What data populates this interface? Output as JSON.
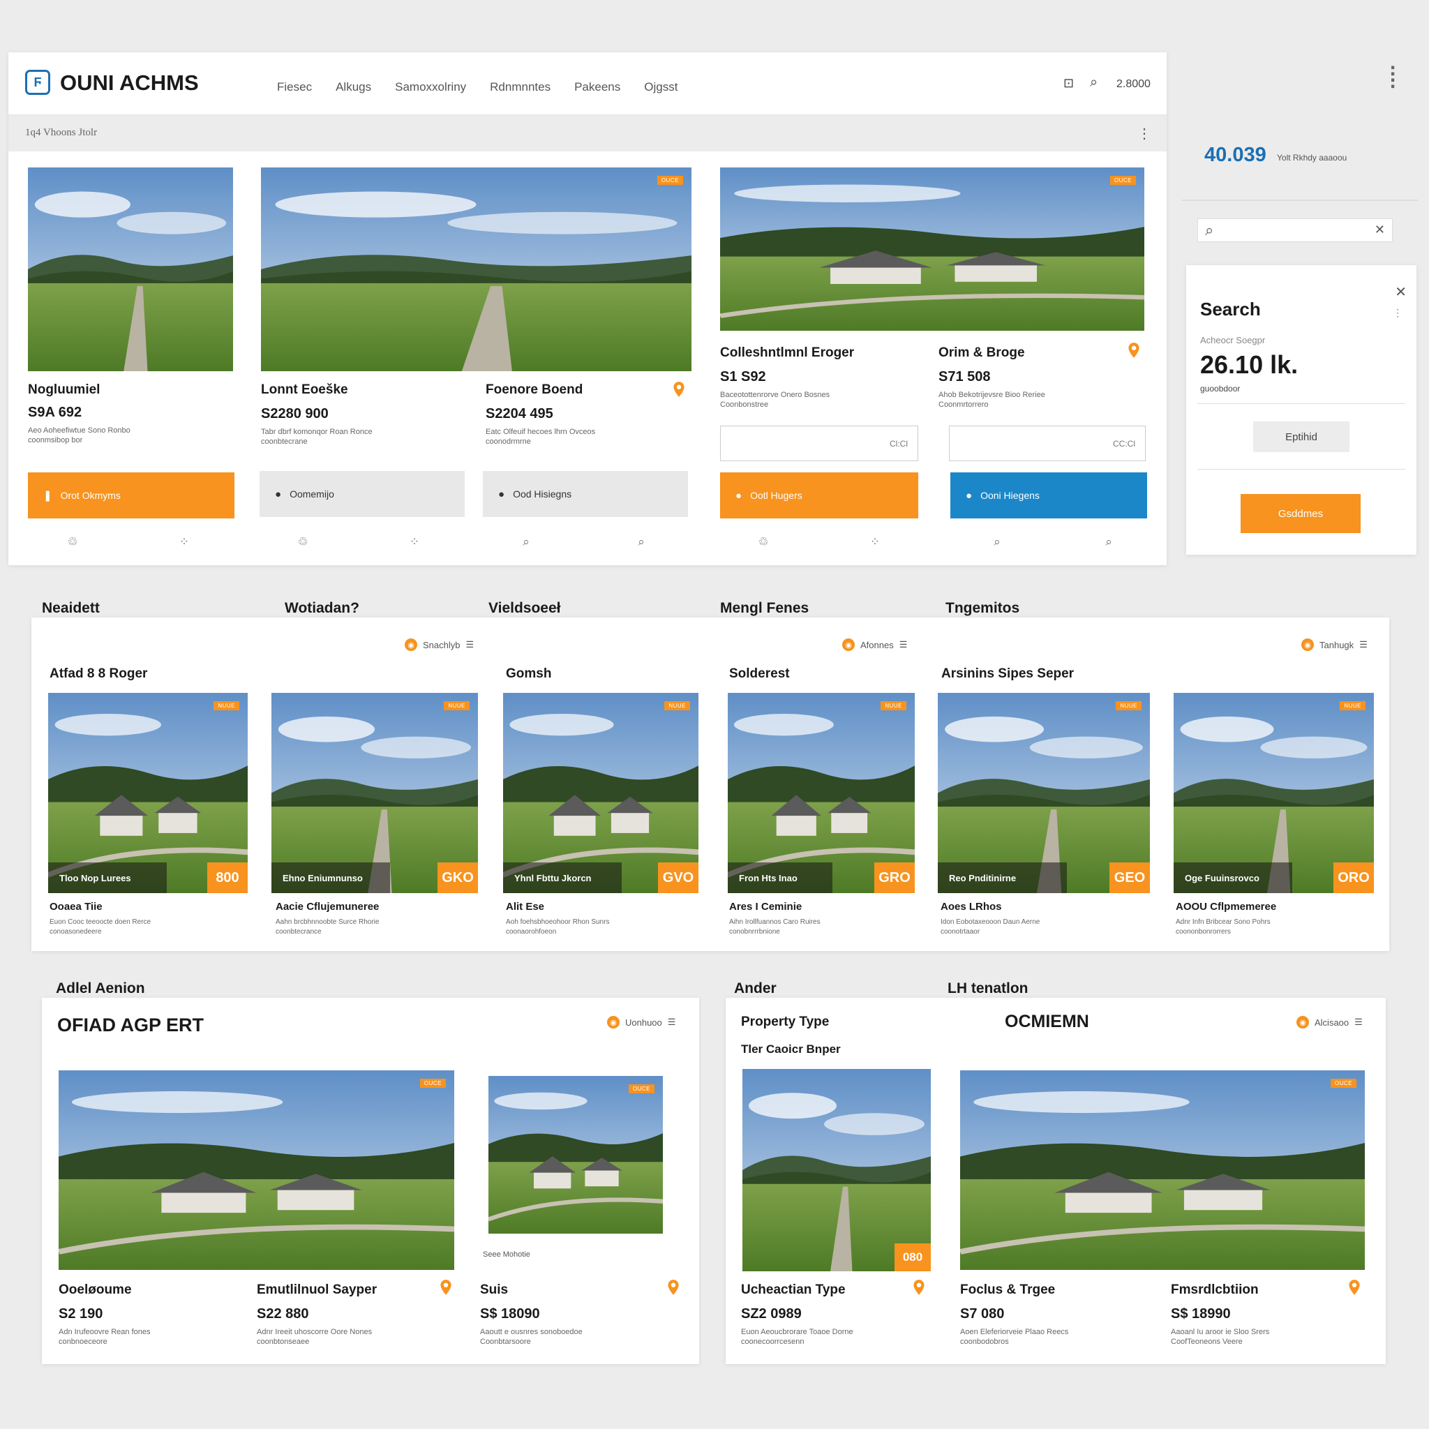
{
  "header": {
    "brand": "OUNI ACHMS",
    "nav": [
      "Fiesec",
      "Alkugs",
      "Samoxxolriny",
      "Rdnmnntes",
      "Pakeens",
      "Ojgsst"
    ],
    "counter": "2.8000",
    "subbar_label": "1q4 Vhoons Jtolr"
  },
  "side": {
    "stat_value": "40.039",
    "stat_label": "Yolt Rkhdy aaaoou",
    "search_title": "Search",
    "search_sub": "Acheocr Soegpr",
    "big_value": "26.10 lk.",
    "big_sub": "guoobdoor",
    "filter_label": "Eptihid",
    "cta_label": "Gsddmes"
  },
  "row1": [
    {
      "title": "Nogluumiel",
      "price": "S9A 692",
      "desc": "Aeo Aoheefiwtue Sono Ronbo\ncoonmsibop bor",
      "button": "Orot Okmyms",
      "btn_style": "orange"
    },
    {
      "title": "Lonnt Eoeške",
      "price": "S2280 900",
      "desc": "Tabr dbrf komonqor Roan Ronce\ncoonbtecrane",
      "button": "Oomemijo",
      "btn_style": "grey"
    },
    {
      "title": "Foenore Boend",
      "price": "S2204 495",
      "desc": "Eatc Olfeuif hecoes lhrn Ovceos\ncoonodrmrne",
      "button": "Ood Hisiegns",
      "btn_style": "grey"
    },
    {
      "title": "Colleshntlmnl Eroger",
      "price": "S1 S92",
      "desc": "Baceotottenrorve Onero Bosnes\nCoonbonstree",
      "button": "Ootl Hugers",
      "btn_style": "orange"
    },
    {
      "title": "Orim & Broge",
      "price": "S71 508",
      "desc": "Ahob Bekotrijevsre Bioo Reriee\nCoonmrtorrero",
      "button": "Ooni Hiegens",
      "btn_style": "blue"
    }
  ],
  "row1_inputs": [
    "Cl:Cl",
    "CC:Cl"
  ],
  "row1_photo_tags": [
    "OUCE",
    "OUCE",
    "OUCE"
  ],
  "section_titles": [
    "Neaidett",
    "Wotiadan?",
    "Vieldsoeeł",
    "Mengl Fenes",
    "Tngemitos"
  ],
  "row2": {
    "filters": [
      "Snachlyb",
      "Afonnes",
      "Tanhugk"
    ],
    "group_titles": [
      "Atfad 8 8 Roger",
      "Gomsh",
      "Solderest",
      "Arsinins Sipes Seper"
    ],
    "tag_label": "NUUE",
    "cards": [
      {
        "overlay": "Tloo Nop Lurees",
        "badge": "800",
        "title": "Ooaea Tiie",
        "desc": "Euon Cooc teeoocte doen Rerce\nconoasonedeere"
      },
      {
        "overlay": "Ehno Eniumnunso",
        "badge": "GKO",
        "title": "Aacie Cflujemuneree",
        "desc": "Aahn brcbhnnoobte Surce Rhorie\ncoonbtecrance"
      },
      {
        "overlay": "Yhnl Fbttu Jkorcn",
        "badge": "GVO",
        "title": "Alit Ese",
        "desc": "Aoh foehsbhoeohoor Rhon Sunrs\ncoonaorohfoeon"
      },
      {
        "overlay": "Fron Hts Inao",
        "badge": "GRO",
        "title": "Ares I Ceminie",
        "desc": "Aihn Irollfuannos Caro Ruires\nconobnrrrbnione"
      },
      {
        "overlay": "Reo Pnditinirne",
        "badge": "GEO",
        "title": "Aoes LRhos",
        "desc": "Idon Eobotaxeooon Daun Aerne\ncoonotrtaaor"
      },
      {
        "overlay": "Oge Fuuinsrovco",
        "badge": "ORO",
        "title": "AOOU Cflpmemeree",
        "desc": "Adnr Infn Bribcear Sono Pohrs\ncoononbonrorrers"
      }
    ]
  },
  "row3_labels": [
    "Adlel Aenion",
    "Ander",
    "LH tenatlon"
  ],
  "row3_left": {
    "title": "OFIAD AGP ERT",
    "filter": "Uonhuoo",
    "small_caption": "Seee Mohotie",
    "tag_label": "OUCE",
    "items": [
      {
        "title": "Ooeløoume",
        "price": "S2 190",
        "desc": "Adn Irufeoovre Rean fones\nconbnoeceore"
      },
      {
        "title": "Emutlilnuol Sayper",
        "price": "S22 880",
        "desc": "Adnr Ireeit uhoscorre Oore Nones\ncoonbtonseaee"
      },
      {
        "title": "Suis",
        "price": "S$ 18090",
        "desc": "Aaoutt e ousnres sonoboedoe\nCoonbtarsoore"
      }
    ]
  },
  "row3_right": {
    "heading_left": "Property Type",
    "heading_center": "OCMIEMN",
    "sub_heading": "Tler Caoicr Bnper",
    "filter": "Alcisaoo",
    "badge": "080",
    "tag_label": "OUCE",
    "items": [
      {
        "title": "Ucheactian Type",
        "price": "SZ2 0989",
        "desc": "Euon Aeoucbrorare Toaoe Dorne\ncoonecoorrcesenn"
      },
      {
        "title": "Foclus & Trgee",
        "price": "S7 080",
        "desc": "Aoen Eleferiorveie Plaao Reecs\ncoonbodobros"
      },
      {
        "title": "Fmsrdlcbtiion",
        "price": "S$ 18990",
        "desc": "Aaoanl Iu aroor ie Sloo Srers\nCoofTeoneons Veere"
      }
    ]
  },
  "colors": {
    "accent": "#f7931e",
    "blue": "#1b87c9",
    "logo": "#1b6fb3"
  },
  "icons": [
    "logo-icon",
    "cart-icon",
    "search-icon",
    "more-vert-icon",
    "close-icon",
    "location-pin-icon",
    "grid-icon",
    "share-icon",
    "bookmark-icon"
  ]
}
